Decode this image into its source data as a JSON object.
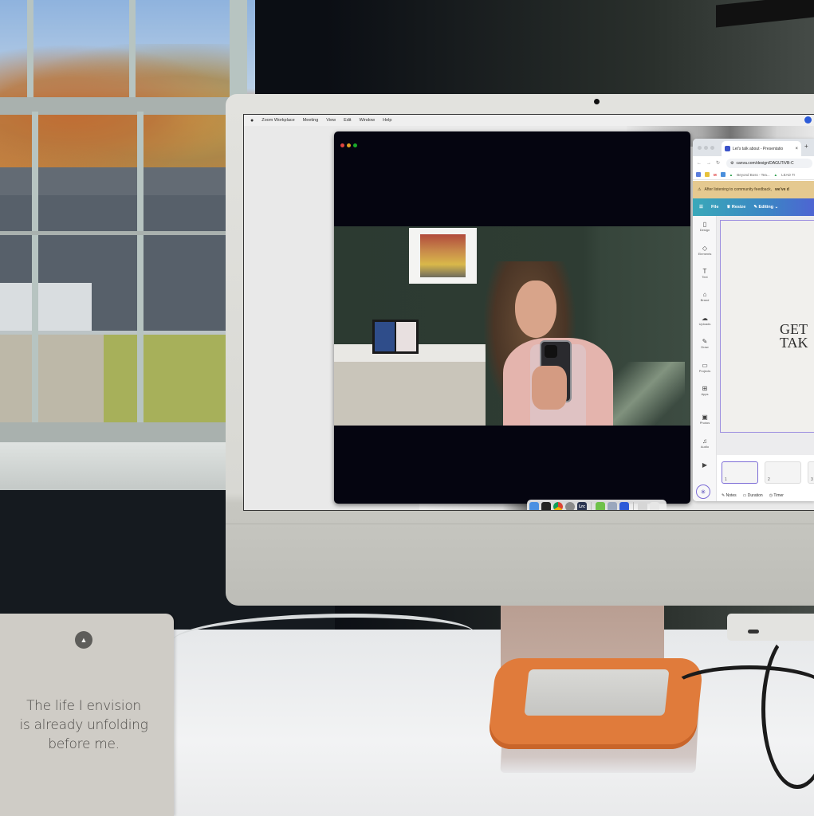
{
  "scene": {
    "card": {
      "lines": [
        "The life I envision",
        "is already unfolding",
        "before me."
      ],
      "icon": "triangle-up-icon"
    }
  },
  "menubar": {
    "apple": "",
    "items": [
      "Zoom Workplace",
      "Meeting",
      "View",
      "Edit",
      "Window",
      "Help"
    ]
  },
  "zoom_window": {
    "traffic_lights": {
      "close": "#e0443e",
      "minimize": "#dea123",
      "zoom": "#1aab29"
    }
  },
  "browser": {
    "tab_title": "Let's talk about - Presentatio",
    "tab_close": "×",
    "new_tab": "+",
    "nav": {
      "back": "←",
      "forward": "→",
      "reload": "↻"
    },
    "url": "canva.com/design/DAGUTiVB-C",
    "bookmarks": [
      "Beyond Boss - Tea...",
      "LEAD Tr"
    ],
    "banner": {
      "text": "After listening to community feedback,",
      "bold": "we've d"
    }
  },
  "canva": {
    "toolbar": {
      "menu": "☰",
      "file": "File",
      "resize": "Resize",
      "editing": "Editing"
    },
    "sidebar": [
      {
        "label": "Design",
        "icon": "▯"
      },
      {
        "label": "Elements",
        "icon": "◇"
      },
      {
        "label": "Text",
        "icon": "T"
      },
      {
        "label": "Brand",
        "icon": "⌂"
      },
      {
        "label": "Uploads",
        "icon": "☁"
      },
      {
        "label": "Draw",
        "icon": "✎"
      },
      {
        "label": "Projects",
        "icon": "▭"
      },
      {
        "label": "Apps",
        "icon": "⊞"
      },
      {
        "label": "Photos",
        "icon": "▣"
      },
      {
        "label": "Audio",
        "icon": "♫"
      },
      {
        "label": "",
        "icon": "▶"
      }
    ],
    "magic_button": "✳",
    "slide_title_lines": [
      "GET",
      "TAK"
    ],
    "thumbnails": [
      {
        "num": "1"
      },
      {
        "num": "2"
      },
      {
        "num": "3"
      }
    ],
    "footer": {
      "notes": "Notes",
      "duration": "Duration",
      "timer": "Timer"
    }
  },
  "dock": {
    "apps": [
      {
        "name": "Finder",
        "color": "#4a90e2",
        "glyph": ""
      },
      {
        "name": "Mission Control",
        "color": "#222222",
        "glyph": ""
      },
      {
        "name": "Chrome",
        "color": "#e8b02b",
        "glyph": ""
      },
      {
        "name": "System Settings",
        "color": "#8a8a8a",
        "glyph": ""
      },
      {
        "name": "Lightroom Classic",
        "color": "#2a3450",
        "glyph": "Lrc"
      },
      {
        "name": "FaceTime",
        "color": "#6fc14a",
        "glyph": ""
      },
      {
        "name": "Preview",
        "color": "#9aa7bd",
        "glyph": ""
      },
      {
        "name": "Zoom",
        "color": "#2d5bd8",
        "glyph": ""
      }
    ],
    "trailing": [
      {
        "name": "Downloads",
        "color": "#d6d6d6"
      },
      {
        "name": "Trash",
        "color": "#e6e6e6"
      }
    ]
  }
}
